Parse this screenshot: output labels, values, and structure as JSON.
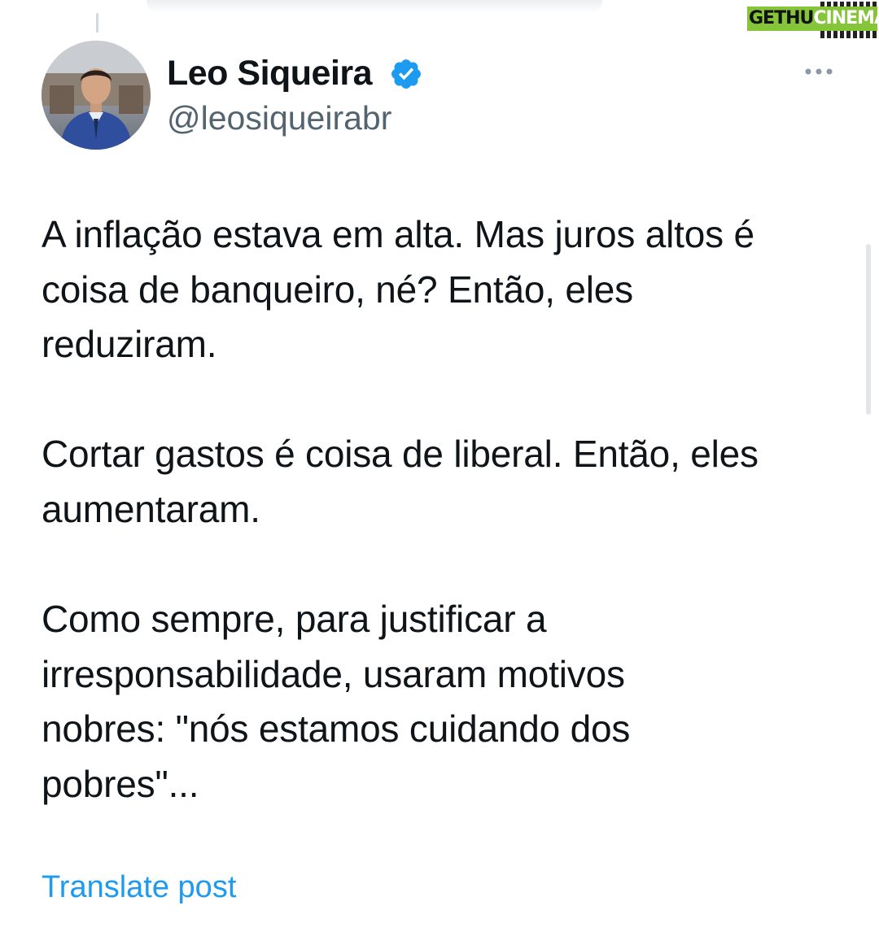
{
  "watermark": {
    "part1": "GETHU",
    "part2": "CINEMA",
    "color": "#86c43a"
  },
  "post": {
    "author_name": "Leo Siqueira",
    "handle": "@leosiqueirabr",
    "verified_color": "#1d9bf0",
    "more_icon": "more-horizontal-icon",
    "paragraph1": [
      "A inflação estava em alta. Mas juros altos é",
      "coisa de banqueiro, né? Então, eles",
      "reduziram."
    ],
    "paragraph2": [
      "Cortar gastos é coisa de liberal. Então, eles",
      "aumentaram."
    ],
    "paragraph3": [
      "Como sempre, para justificar a",
      "irresponsabilidade, usaram motivos",
      "nobres: \"nós estamos cuidando dos",
      "pobres\"..."
    ],
    "translate_label": "Translate post",
    "translate_color": "#1d9bf0"
  }
}
